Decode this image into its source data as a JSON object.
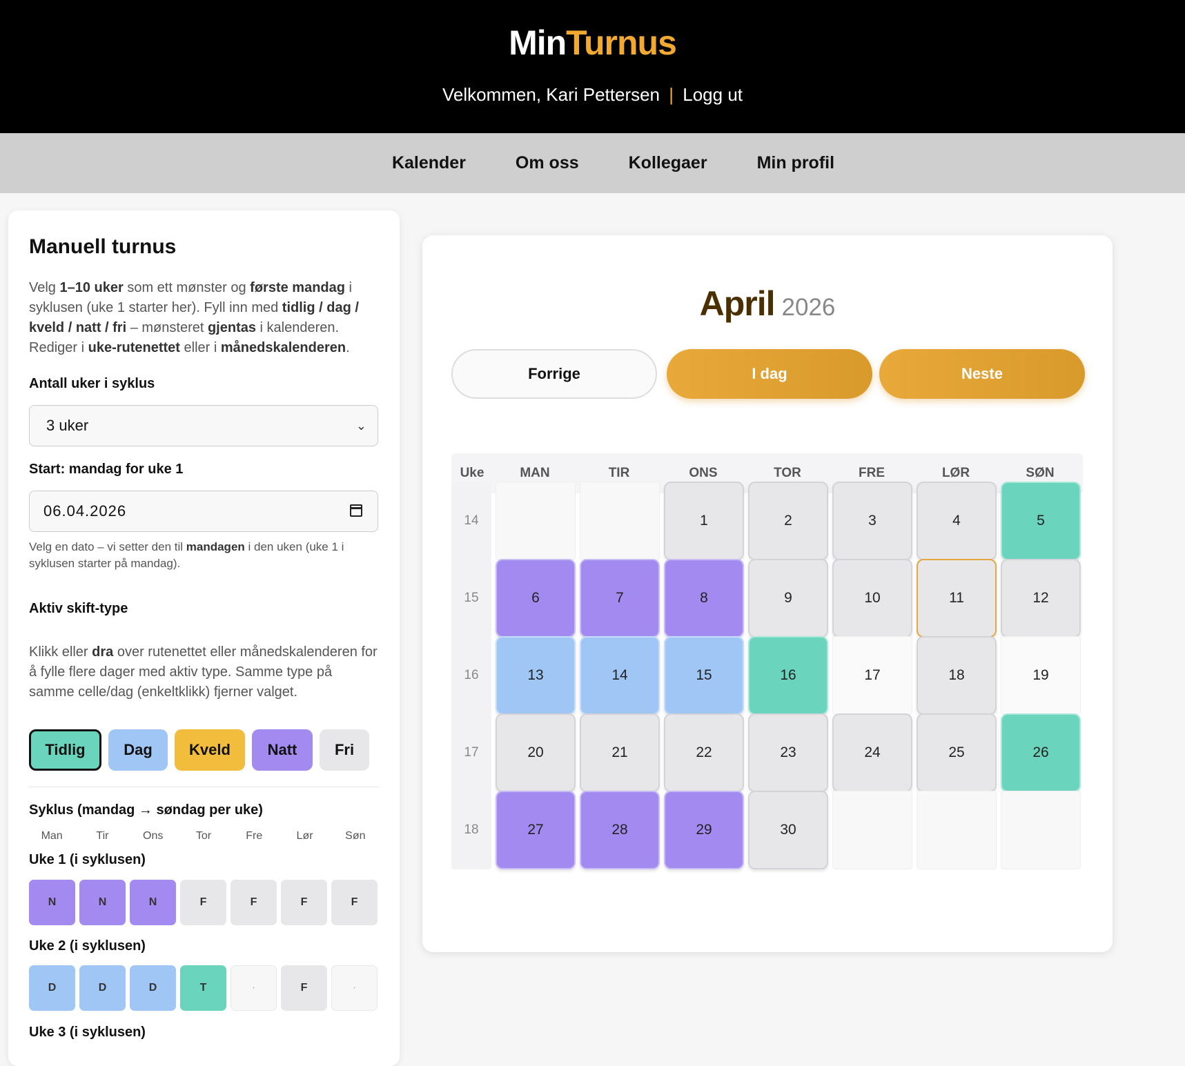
{
  "header": {
    "logo_part1": "Min",
    "logo_part2": "Turnus",
    "welcome_prefix": "Velkommen, Kari Pettersen",
    "separator": "|",
    "logout": "Logg ut"
  },
  "nav": [
    "Kalender",
    "Om oss",
    "Kollegaer",
    "Min profil"
  ],
  "panel": {
    "title": "Manuell turnus",
    "intro": {
      "t1": "Velg ",
      "b1": "1–10 uker",
      "t2": " som ett mønster og ",
      "b2": "første mandag",
      "t3": " i syklusen (uke 1 starter her). Fyll inn med ",
      "b3": "tidlig / dag / kveld / natt / fri",
      "t4": " – mønsteret ",
      "b4": "gjentas",
      "t5": " i kalenderen. Rediger i ",
      "b5": "uke-rutenettet",
      "t6": " eller i ",
      "b6": "månedskalenderen",
      "t7": "."
    },
    "weeks_label": "Antall uker i syklus",
    "weeks_value": "3 uker",
    "start_label": "Start: mandag for uke 1",
    "start_value": "06.04.2026",
    "hint": {
      "t1": "Velg en dato – vi setter den til ",
      "b1": "mandagen",
      "t2": " i den uken (uke 1 i syklusen starter på mandag)."
    },
    "active_label": "Aktiv skift-type",
    "help": {
      "t1": "Klikk eller ",
      "b1": "dra",
      "t2": " over rutenettet eller månedskalenderen for å fylle flere dager med aktiv type. Samme type på samme celle/dag (enkeltklikk) fjerner valget."
    },
    "types": [
      "Tidlig",
      "Dag",
      "Kveld",
      "Natt",
      "Fri"
    ],
    "cycle_label": "Syklus (mandag → søndag per uke)",
    "cycle_days": [
      "Man",
      "Tir",
      "Ons",
      "Tor",
      "Fre",
      "Lør",
      "Søn"
    ],
    "cycle_weeks": [
      {
        "label": "Uke 1 (i syklusen)",
        "cells": [
          "N",
          "N",
          "N",
          "F",
          "F",
          "F",
          "F"
        ]
      },
      {
        "label": "Uke 2 (i syklusen)",
        "cells": [
          "D",
          "D",
          "D",
          "T",
          "·",
          "F",
          "·"
        ]
      },
      {
        "label": "Uke 3 (i syklusen)",
        "cells": []
      }
    ]
  },
  "calendar": {
    "month": "April",
    "year": "2026",
    "prev": "Forrige",
    "today": "I dag",
    "next": "Neste",
    "week_col": "Uke",
    "days": [
      "MAN",
      "TIR",
      "ONS",
      "TOR",
      "FRE",
      "LØR",
      "SØN"
    ],
    "weeks": [
      {
        "num": "14",
        "cells": [
          {
            "d": "",
            "t": "blank"
          },
          {
            "d": "",
            "t": "blank"
          },
          {
            "d": "1",
            "t": "F"
          },
          {
            "d": "2",
            "t": "F"
          },
          {
            "d": "3",
            "t": "F"
          },
          {
            "d": "4",
            "t": "F"
          },
          {
            "d": "5",
            "t": "T"
          }
        ]
      },
      {
        "num": "15",
        "cells": [
          {
            "d": "6",
            "t": "N"
          },
          {
            "d": "7",
            "t": "N"
          },
          {
            "d": "8",
            "t": "N"
          },
          {
            "d": "9",
            "t": "F"
          },
          {
            "d": "10",
            "t": "F"
          },
          {
            "d": "11",
            "t": "F",
            "today": true
          },
          {
            "d": "12",
            "t": "F"
          }
        ]
      },
      {
        "num": "16",
        "cells": [
          {
            "d": "13",
            "t": "D"
          },
          {
            "d": "14",
            "t": "D"
          },
          {
            "d": "15",
            "t": "D"
          },
          {
            "d": "16",
            "t": "T"
          },
          {
            "d": "17",
            "t": "plain"
          },
          {
            "d": "18",
            "t": "F"
          },
          {
            "d": "19",
            "t": "plain"
          }
        ]
      },
      {
        "num": "17",
        "cells": [
          {
            "d": "20",
            "t": "F"
          },
          {
            "d": "21",
            "t": "F"
          },
          {
            "d": "22",
            "t": "F"
          },
          {
            "d": "23",
            "t": "F"
          },
          {
            "d": "24",
            "t": "F"
          },
          {
            "d": "25",
            "t": "F"
          },
          {
            "d": "26",
            "t": "T"
          }
        ]
      },
      {
        "num": "18",
        "cells": [
          {
            "d": "27",
            "t": "N"
          },
          {
            "d": "28",
            "t": "N"
          },
          {
            "d": "29",
            "t": "N"
          },
          {
            "d": "30",
            "t": "F"
          },
          {
            "d": "",
            "t": "blank"
          },
          {
            "d": "",
            "t": "blank"
          },
          {
            "d": "",
            "t": "blank"
          }
        ]
      }
    ]
  },
  "colors": {
    "accent": "#f2a931",
    "tidlig": "#6ad4bd",
    "dag": "#9fc6f5",
    "kveld": "#f2bd3c",
    "natt": "#a38af0",
    "fri": "#e7e7ea"
  }
}
